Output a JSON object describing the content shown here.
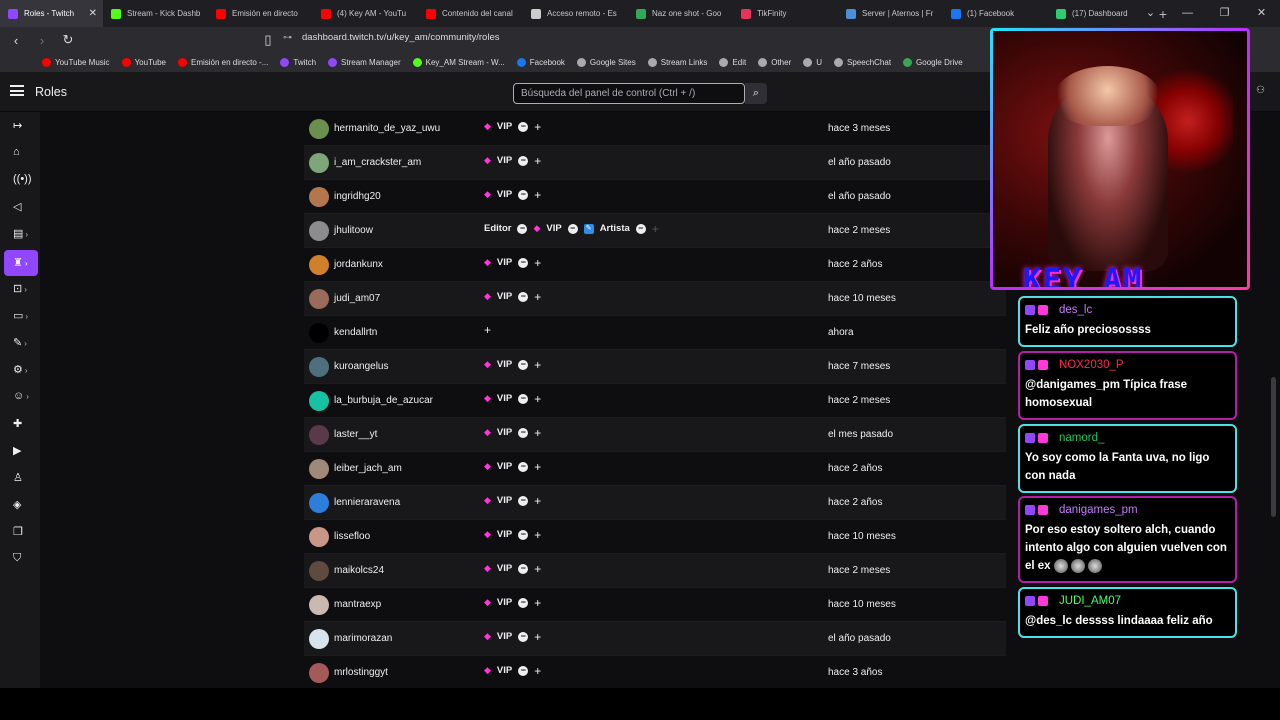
{
  "browser": {
    "tabs": [
      {
        "title": "Roles - Twitch",
        "color": "#9147ff",
        "active": true
      },
      {
        "title": "Stream - Kick Dashb",
        "color": "#53fc18"
      },
      {
        "title": "Emisión en directo",
        "color": "#ff0000"
      },
      {
        "title": "(4) Key AM - YouTu",
        "color": "#ff0000"
      },
      {
        "title": "Contenido del canal",
        "color": "#ff0000"
      },
      {
        "title": "Acceso remoto - Es",
        "color": "#cccccc"
      },
      {
        "title": "Naz one shot - Goo",
        "color": "#34a853"
      },
      {
        "title": "TikFinity",
        "color": "#e8335a"
      },
      {
        "title": "Server | Aternos | Fr",
        "color": "#4a90d9"
      },
      {
        "title": "(1) Facebook",
        "color": "#1877f2"
      },
      {
        "title": "(17) Dashboard",
        "color": "#2ecc71"
      }
    ],
    "url": "dashboard.twitch.tv/u/key_am/community/roles",
    "bookmarks": [
      {
        "label": "YouTube Music",
        "color": "#ff0000"
      },
      {
        "label": "YouTube",
        "color": "#ff0000"
      },
      {
        "label": "Emisión en directo -...",
        "color": "#ff0000"
      },
      {
        "label": "Twitch",
        "color": "#9147ff"
      },
      {
        "label": "Stream Manager",
        "color": "#9147ff"
      },
      {
        "label": "Key_AM Stream - W...",
        "color": "#53fc18"
      },
      {
        "label": "Facebook",
        "color": "#1877f2"
      },
      {
        "label": "Google Sites",
        "color": "#aaaaaa"
      },
      {
        "label": "Stream Links",
        "color": "#aaaaaa"
      },
      {
        "label": "Edit",
        "color": "#aaaaaa"
      },
      {
        "label": "Other",
        "color": "#aaaaaa"
      },
      {
        "label": "U",
        "color": "#aaaaaa"
      },
      {
        "label": "SpeechChat",
        "color": "#aaaaaa"
      },
      {
        "label": "Google Drive",
        "color": "#34a853"
      }
    ]
  },
  "header": {
    "title": "Roles",
    "search_placeholder": "Búsqueda del panel de control (Ctrl + /)"
  },
  "roles_table": {
    "rows": [
      {
        "user": "hermanito_de_yaz_uwu",
        "avatar": "#6b8f4e",
        "roles": [
          "VIP"
        ],
        "date": "hace 3 meses"
      },
      {
        "user": "i_am_crackster_am",
        "avatar": "#7fa67a",
        "roles": [
          "VIP"
        ],
        "date": "el año pasado"
      },
      {
        "user": "ingridhg20",
        "avatar": "#b4774c",
        "roles": [
          "VIP"
        ],
        "date": "el año pasado"
      },
      {
        "user": "jhulitoow",
        "avatar": "#8c8c8c",
        "roles": [
          "Editor",
          "VIP",
          "Artista"
        ],
        "date": "hace 2 meses"
      },
      {
        "user": "jordankunx",
        "avatar": "#d0802a",
        "roles": [
          "VIP"
        ],
        "date": "hace 2 años"
      },
      {
        "user": "judi_am07",
        "avatar": "#9a6a5a",
        "roles": [
          "VIP"
        ],
        "date": "hace 10 meses"
      },
      {
        "user": "kendallrtn",
        "avatar": "#000000",
        "roles": [],
        "date": "ahora"
      },
      {
        "user": "kuroangelus",
        "avatar": "#4f6f7f",
        "roles": [
          "VIP"
        ],
        "date": "hace 7 meses"
      },
      {
        "user": "la_burbuja_de_azucar",
        "avatar": "#16c2a3",
        "roles": [
          "VIP"
        ],
        "date": "hace 2 meses"
      },
      {
        "user": "laster__yt",
        "avatar": "#5a3a4a",
        "roles": [
          "VIP"
        ],
        "date": "el mes pasado"
      },
      {
        "user": "leiber_jach_am",
        "avatar": "#9f8a7a",
        "roles": [
          "VIP"
        ],
        "date": "hace 2 años"
      },
      {
        "user": "lennieraravena",
        "avatar": "#2d7ddb",
        "roles": [
          "VIP"
        ],
        "date": "hace 2 años"
      },
      {
        "user": "lissefloo",
        "avatar": "#c9968a",
        "roles": [
          "VIP"
        ],
        "date": "hace 10 meses"
      },
      {
        "user": "maikolcs24",
        "avatar": "#5e4a3f",
        "roles": [
          "VIP"
        ],
        "date": "hace 2 meses"
      },
      {
        "user": "mantraexp",
        "avatar": "#c9b9b0",
        "roles": [
          "VIP"
        ],
        "date": "hace 10 meses"
      },
      {
        "user": "marimorazan",
        "avatar": "#d8e4ec",
        "roles": [
          "VIP"
        ],
        "date": "el año pasado"
      },
      {
        "user": "mrlostinggyt",
        "avatar": "#a55a5a",
        "roles": [
          "VIP"
        ],
        "date": "hace 3 años"
      }
    ]
  },
  "chat": [
    {
      "name": "des_lc",
      "name_color": "#c679ff",
      "message": "Feliz año preciosossss",
      "border": "cyan"
    },
    {
      "name": "NOX2030_P",
      "name_color": "#ff2a4a",
      "message": "@danigames_pm Típica frase homosexual",
      "border": "pink"
    },
    {
      "name": "namord_",
      "name_color": "#1fc35c",
      "message": "Yo soy como la Fanta uva, no ligo con nada",
      "border": "cyan"
    },
    {
      "name": "danigames_pm",
      "name_color": "#c679ff",
      "message": "Por eso estoy soltero alch, cuando intento algo con alguien vuelven con el ex",
      "border": "pink"
    },
    {
      "name": "JUDI_AM07",
      "name_color": "#46ff6a",
      "message": "@des_lc dessss lindaaaa feliz año",
      "border": "cyan"
    }
  ],
  "overlay": {
    "logo_text": "KEY_AM"
  }
}
